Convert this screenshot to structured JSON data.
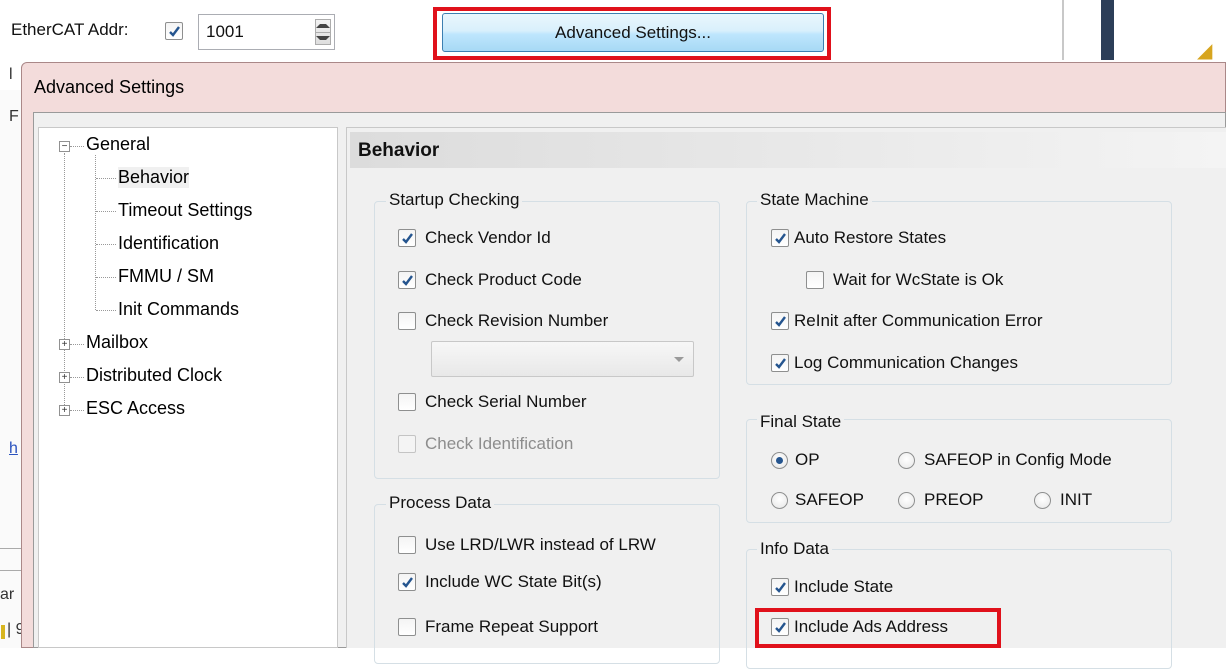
{
  "parent": {
    "ethercat_label": "EtherCAT Addr:",
    "ethercat_checked": true,
    "ethercat_value": "1001",
    "advanced_button_label": "Advanced Settings...",
    "fragments": [
      "l",
      "F",
      "h",
      "ar",
      "| 9"
    ]
  },
  "dialog": {
    "title": "Advanced Settings",
    "tree": {
      "general": "General",
      "children": [
        "Behavior",
        "Timeout Settings",
        "Identification",
        "FMMU / SM",
        "Init Commands"
      ],
      "mailbox": "Mailbox",
      "distributed_clock": "Distributed Clock",
      "esc_access": "ESC Access",
      "selected": "Behavior"
    },
    "panel_title": "Behavior",
    "startup_checking": {
      "label": "Startup Checking",
      "check_vendor_id": {
        "label": "Check Vendor Id",
        "checked": true
      },
      "check_product_code": {
        "label": "Check Product Code",
        "checked": true
      },
      "check_revision_number": {
        "label": "Check Revision Number",
        "checked": false
      },
      "revision_combo_value": "",
      "check_serial_number": {
        "label": "Check Serial Number",
        "checked": false
      },
      "check_identification": {
        "label": "Check Identification",
        "checked": false,
        "disabled": true
      }
    },
    "process_data": {
      "label": "Process Data",
      "use_lrd_lwr": {
        "label": "Use LRD/LWR instead of LRW",
        "checked": false
      },
      "include_wc_state": {
        "label": "Include WC State Bit(s)",
        "checked": true
      },
      "frame_repeat": {
        "label": "Frame Repeat Support",
        "checked": false
      }
    },
    "state_machine": {
      "label": "State Machine",
      "auto_restore": {
        "label": "Auto Restore States",
        "checked": true
      },
      "wait_wcstate": {
        "label": "Wait for WcState is Ok",
        "checked": false
      },
      "reinit": {
        "label": "ReInit after Communication Error",
        "checked": true
      },
      "log_changes": {
        "label": "Log Communication Changes",
        "checked": true
      }
    },
    "final_state": {
      "label": "Final State",
      "options": [
        "OP",
        "SAFEOP in Config Mode",
        "SAFEOP",
        "PREOP",
        "INIT"
      ],
      "selected": "OP"
    },
    "info_data": {
      "label": "Info Data",
      "include_state": {
        "label": "Include State",
        "checked": true
      },
      "include_ads": {
        "label": "Include Ads Address",
        "checked": true
      }
    }
  },
  "colors": {
    "highlight": "#e0111b",
    "dialog_frame": "#f3dcdb",
    "check_mark": "#25558f"
  }
}
